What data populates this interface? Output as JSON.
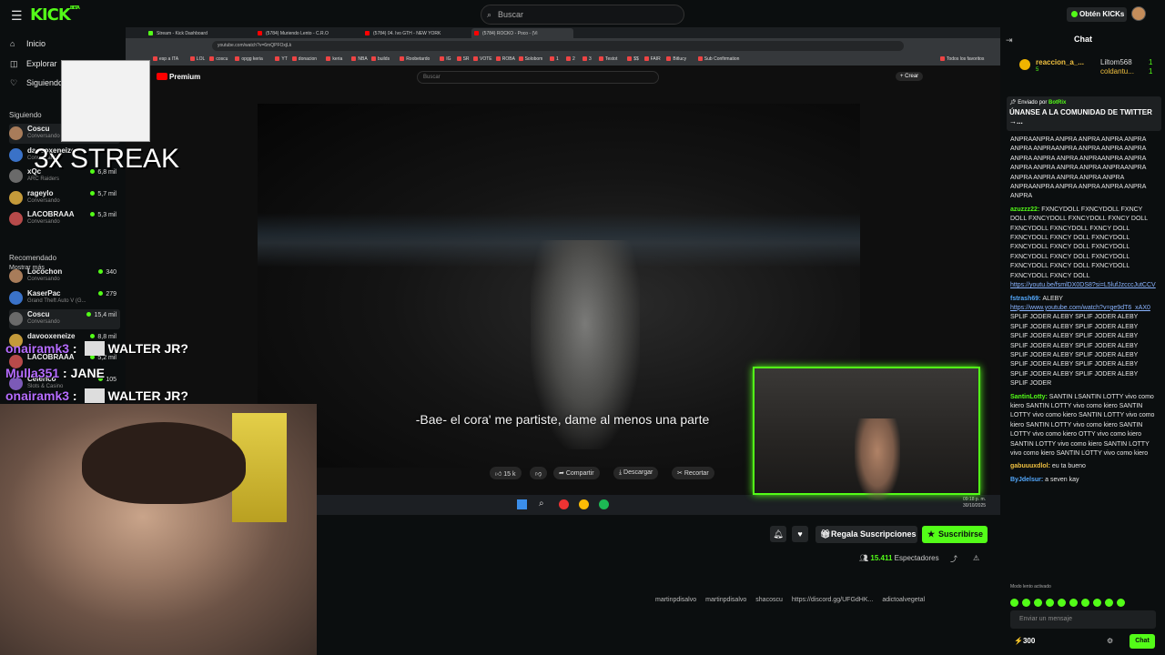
{
  "app": {
    "logo": "KICK",
    "logo_sup": "BETA"
  },
  "topbar": {
    "search_placeholder": "Buscar",
    "get_kicks": "Obtén KICKs"
  },
  "sidebar": {
    "nav": [
      {
        "label": "Inicio",
        "icon": "home-icon"
      },
      {
        "label": "Explorar",
        "icon": "compass-icon"
      },
      {
        "label": "Siguiendo",
        "icon": "heart-icon"
      }
    ],
    "following_header": "Siguiendo",
    "following": [
      {
        "name": "Coscu",
        "sub": "Conversando",
        "viewers": ""
      },
      {
        "name": "davooxeneize",
        "sub": "Conversando",
        "viewers": ""
      },
      {
        "name": "xQc",
        "sub": "ARC Raiders",
        "viewers": "6,8 mil"
      },
      {
        "name": "rageylo",
        "sub": "Conversando",
        "viewers": "5,7 mil"
      },
      {
        "name": "LACOBRAAA",
        "sub": "Conversando",
        "viewers": "5,3 mil"
      }
    ],
    "show_more": "Mostrar más",
    "recommended_header": "Recomendado",
    "recommended": [
      {
        "name": "Locochon",
        "sub": "Conversando",
        "viewers": "340"
      },
      {
        "name": "KaserPac",
        "sub": "Grand Theft Auto V (G...",
        "viewers": "279"
      },
      {
        "name": "Coscu",
        "sub": "Conversando",
        "viewers": "15,4 mil"
      },
      {
        "name": "davooxeneize",
        "sub": "",
        "viewers": "8,8 mil"
      },
      {
        "name": "LACOBRAAA",
        "sub": "",
        "viewers": "5,2 mil"
      },
      {
        "name": "Celerico",
        "sub": "Slots & Casino",
        "viewers": "105"
      }
    ]
  },
  "overlay": {
    "meme_text": "3x STREAK",
    "chat_lines": [
      {
        "user": "onairamk3",
        "text": "WALTER JR?",
        "emote": true
      },
      {
        "user": "Mulla351",
        "text": "JANE",
        "emote": false
      },
      {
        "user": "onairamk3",
        "text": "WALTER JR?",
        "emote": true
      }
    ]
  },
  "browser": {
    "tabs": [
      {
        "label": "Stream - Kick Dashboard",
        "color": "#53fc18"
      },
      {
        "label": "(5784) Muriendo Lento - C.R.O",
        "color": "#ff0000"
      },
      {
        "label": "(5784) 04. Ivo GTH - NEW YORK",
        "color": "#ff0000"
      },
      {
        "label": "(5784) ROCKO - Poco - (Vi",
        "color": "#ff0000"
      }
    ],
    "url": "youtube.com/watch?v=6mQPFOxjLk",
    "bookmarks": [
      "esp a ITA",
      "LOL",
      "coscu",
      "opgg keria",
      "YT",
      "donacion",
      "keria",
      "NBA",
      "builds",
      "Roobetardo",
      "IG",
      "SR",
      "VOTE",
      "ROBA",
      "Solobom",
      "1",
      "2",
      "3",
      "Testot",
      "$$",
      "FAIR",
      "Bitlucy",
      "Sub Confirmation"
    ],
    "bookmarks_all": "Todos los favoritos",
    "yt_logo": "Premium",
    "yt_search": "Buscar",
    "yt_create": "+ Crear",
    "subtitle": "-Bae- el cora' me partiste, dame al menos una parte",
    "likes": "15 k",
    "share": "Compartir",
    "download": "Descargar",
    "clip": "Recortar",
    "clock_time": "09:18 p. m.",
    "clock_date": "30/10/2025"
  },
  "stream": {
    "gift_subs": "Regala Suscripciones",
    "subscribe": "Suscribirse",
    "viewers": "15.411",
    "viewers_label": "Espectadores",
    "socials": [
      "martinpdisalvo",
      "martinpdisalvo",
      "shacoscu",
      "https://discord.gg/UFGdHK...",
      "adictoalvegetal"
    ]
  },
  "chat": {
    "title": "Chat",
    "gifters": [
      {
        "name": "reaccion_a_...",
        "count": "5"
      },
      {
        "name": "Liltom568",
        "count": "1"
      },
      {
        "name": "coldantu...",
        "count": "1"
      }
    ],
    "pinned_by_label": "Enviado por",
    "pinned_by": "BotRix",
    "pinned_title": "ÚNANSE A LA COMUNIDAD DE TWITTER →...",
    "messages": [
      {
        "user": "",
        "color": "#fff",
        "text": "ANPRAANPRA ANPRA ANPRA ANPRA ANPRA ANPRA ANPRAANPRA ANPRA ANPRA ANPRA ANPRA ANPRA ANPRA ANPRAANPRA ANPRA ANPRA ANPRA ANPRA ANPRA ANPRAANPRA ANPRA ANPRA ANPRA ANPRA ANPRA ANPRAANPRA ANPRA ANPRA ANPRA ANPRA ANPRA",
        "link": ""
      },
      {
        "user": "azuzzz22:",
        "color": "#53fc18",
        "text": "FXNCYDOLL FXNCYDOLL FXNCY DOLL FXNCYDOLL FXNCYDOLL FXNCY DOLL FXNCYDOLL FXNCYDOLL FXNCY DOLL FXNCYDOLL FXNCY DOLL FXNCYDOLL FXNCYDOLL FXNCY DOLL FXNCYDOLL FXNCYDOLL FXNCY DOLL FXNCYDOLL FXNCYDOLL FXNCY DOLL FXNCYDOLL FXNCYDOLL FXNCY DOLL",
        "link": "https://youtu.be/fsmlDX0DS8?si=L5lufJzcccJutCCV"
      },
      {
        "user": "fstrash69:",
        "color": "#53a8fc",
        "text": "ALEBY",
        "link": "https://www.youtube.com/watch?v=ge9dT6_xAX0",
        "after": "SPLIF JODER ALEBY SPLIF JODER ALEBY SPLIF JODER ALEBY SPLIF JODER ALEBY SPLIF JODER ALEBY SPLIF JODER ALEBY SPLIF JODER ALEBY SPLIF JODER ALEBY SPLIF JODER ALEBY SPLIF JODER ALEBY SPLIF JODER ALEBY SPLIF JODER ALEBY SPLIF JODER ALEBY SPLIF JODER ALEBY SPLIF JODER"
      },
      {
        "user": "SantinLotty:",
        "color": "#53fc18",
        "text": "SANTIN LSANTIN LOTTY vivo como kiero SANTIN LOTTY vivo como kiero SANTIN LOTTY vivo como kiero SANTIN LOTTY vivo como kiero SANTIN LOTTY vivo como kiero SANTIN LOTTY vivo como kiero OTTY vivo como kiero SANTIN LOTTY vivo como kiero SANTIN LOTTY vivo como kiero SANTIN LOTTY vivo como kiero",
        "link": ""
      },
      {
        "user": "gabuuuxdlol:",
        "color": "#f0c040",
        "text": "eu ta bueno",
        "link": ""
      },
      {
        "user": "ByJdelsur:",
        "color": "#53a8fc",
        "text": "a seven kay",
        "link": ""
      }
    ],
    "slow_mode": "Modo lento activado",
    "input_placeholder": "Enviar un mensaje",
    "points": "300",
    "send_label": "Chat"
  },
  "colors": {
    "kick_green": "#53fc18",
    "bg": "#0b0e0f",
    "panel": "#1d2022"
  }
}
